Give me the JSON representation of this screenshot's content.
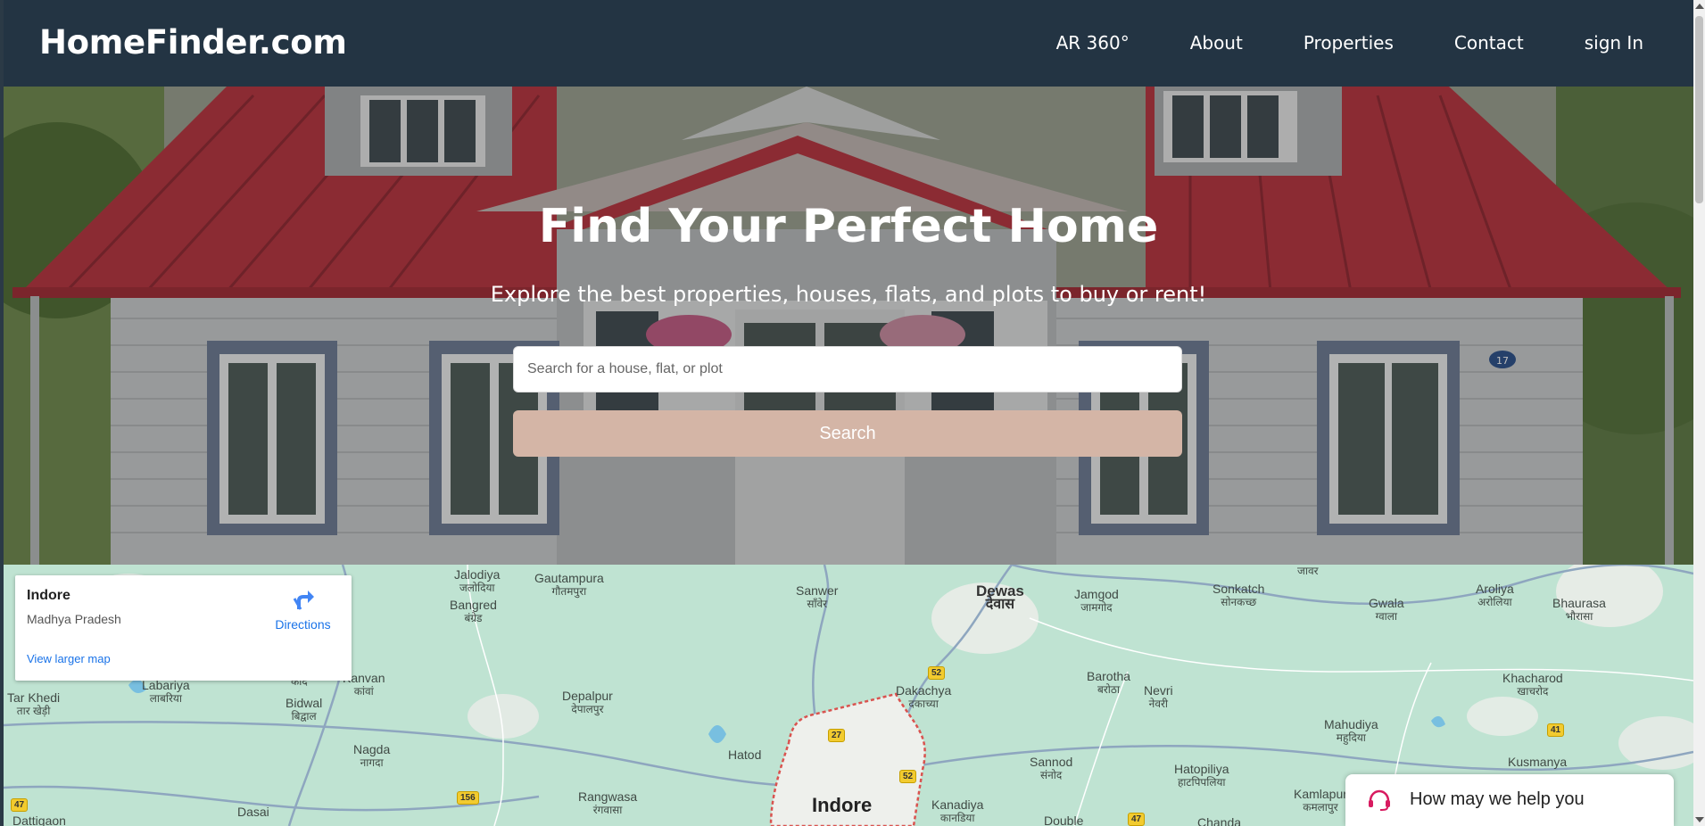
{
  "brand": "HomeFinder.com",
  "nav": {
    "items": [
      "AR 360°",
      "About",
      "Properties",
      "Contact",
      "sign In"
    ]
  },
  "hero": {
    "title": "Find Your Perfect Home",
    "subtitle": "Explore the best properties, houses, flats, and plots to buy or rent!",
    "search_placeholder": "Search for a house, flat, or plot",
    "search_button": "Search",
    "house_number": "17"
  },
  "map": {
    "card": {
      "title": "Indore",
      "subtitle": "Madhya Pradesh",
      "directions": "Directions",
      "view_larger": "View larger map"
    },
    "labels": {
      "jalodiya": {
        "en": "Jalodiya",
        "hi": "जलोदिया"
      },
      "gautampura": {
        "en": "Gautampura",
        "hi": "गौतमपुरा"
      },
      "bangred": {
        "en": "Bangred",
        "hi": "बंग्रेड"
      },
      "sanwer": {
        "en": "Sanwer",
        "hi": "साँवेर"
      },
      "dewas": {
        "en": "Dewas",
        "hi": "देवास"
      },
      "jamgod": {
        "en": "Jamgod",
        "hi": "जामगोद"
      },
      "sonkatch": {
        "en": "Sonkatch",
        "hi": "सोनकच्छ"
      },
      "gwala": {
        "en": "Gwala",
        "hi": "ग्वाला"
      },
      "aroliya": {
        "en": "Aroliya",
        "hi": "अरोलिया"
      },
      "bhaurasa": {
        "en": "Bhaurasa",
        "hi": "भौरासा"
      },
      "jawar": {
        "en": "",
        "hi": "जावर"
      },
      "labariya": {
        "en": "Labariya",
        "hi": "लाबरिया"
      },
      "kanvan": {
        "en": "Kanvan",
        "hi": "कांवां"
      },
      "tarkhedi": {
        "en": "Tar Khedi",
        "hi": "तार खेड़ी"
      },
      "kad": {
        "en": "",
        "hi": "काद"
      },
      "bidwal": {
        "en": "Bidwal",
        "hi": "बिद्वाल"
      },
      "depalpur": {
        "en": "Depalpur",
        "hi": "देपालपुर"
      },
      "dakachya": {
        "en": "Dakachya",
        "hi": "दकाच्या"
      },
      "barotha": {
        "en": "Barotha",
        "hi": "बरोठा"
      },
      "nevri": {
        "en": "Nevri",
        "hi": "नेवरी"
      },
      "khacharod": {
        "en": "Khacharod",
        "hi": "खाचरोद"
      },
      "mahudiya": {
        "en": "Mahudiya",
        "hi": "महुदिया"
      },
      "nagda": {
        "en": "Nagda",
        "hi": "नागदा"
      },
      "hatod": {
        "en": "Hatod",
        "hi": ""
      },
      "sannod": {
        "en": "Sannod",
        "hi": "संनोद"
      },
      "hatopiliya": {
        "en": "Hatopiliya",
        "hi": "हाटपिपलिया"
      },
      "kusmanya": {
        "en": "Kusmanya",
        "hi": ""
      },
      "rangwasa": {
        "en": "Rangwasa",
        "hi": "रंगवासा"
      },
      "kanadiya": {
        "en": "Kanadiya",
        "hi": "कानडिया"
      },
      "kamlapur": {
        "en": "Kamlapur",
        "hi": "कमलापुर"
      },
      "dasai": {
        "en": "Dasai",
        "hi": ""
      },
      "dattigaon": {
        "en": "Dattigaon",
        "hi": ""
      },
      "double": {
        "en": "Double",
        "hi": ""
      },
      "chanda": {
        "en": "Chanda",
        "hi": ""
      },
      "indore": {
        "en": "Indore",
        "hi": ""
      }
    },
    "shields": [
      "52",
      "27",
      "52",
      "156",
      "47",
      "41",
      "47"
    ]
  },
  "help": {
    "text": "How may we help you"
  },
  "colors": {
    "navbar": "#233443",
    "search_button": "#d4b5a6",
    "map_land": "#bfe3d2",
    "link": "#1a73e8"
  }
}
